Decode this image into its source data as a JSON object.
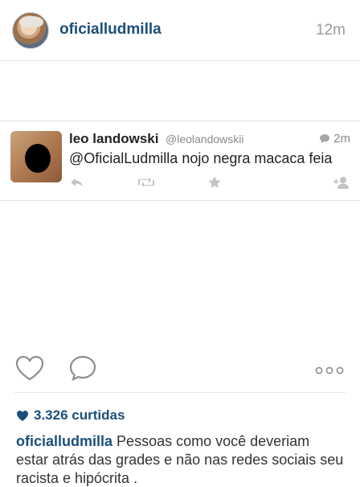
{
  "post": {
    "username": "oficialludmilla",
    "timestamp": "12m"
  },
  "tweet": {
    "name": "leo landowski",
    "handle": "@leolandowskii",
    "time": "2m",
    "text": "@OficialLudmilla nojo negra macaca feia",
    "icons": [
      "reply-icon",
      "retweet-icon",
      "star-icon",
      "follow-icon"
    ]
  },
  "actions": {
    "icons": [
      "heart-icon",
      "comment-icon",
      "more-icon"
    ]
  },
  "likes": {
    "count_text": "3.326 curtidas"
  },
  "caption": {
    "user": "oficialludmilla",
    "text": "Pessoas como você deveriam estar atrás das grades e não nas redes sociais seu racista e hipócrita ."
  },
  "colors": {
    "brand_blue": "#1b4f7a",
    "muted": "#9a9a9a"
  }
}
